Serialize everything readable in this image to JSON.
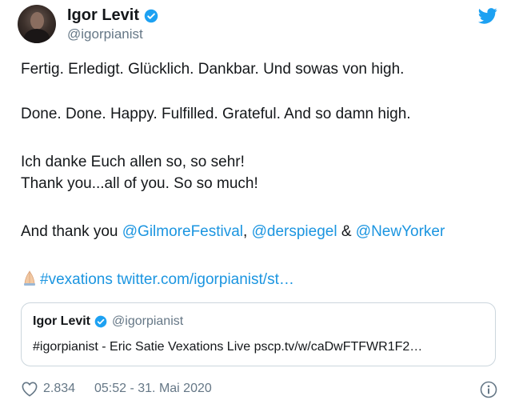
{
  "tweet": {
    "author_name": "Igor Levit",
    "author_handle": "@igorpianist",
    "lines": {
      "l1": "Fertig. Erledigt. Glücklich. Dankbar. Und sowas von high.",
      "l2": "Done. Done. Happy. Fulfilled. Grateful. And so damn high.",
      "l3": "Ich danke Euch allen so, so sehr!",
      "l4": "Thank you...all of you. So so much!",
      "l5_prefix": "And thank you ",
      "l5_link1": "@GilmoreFestival",
      "l5_sep1": ", ",
      "l5_link2": "@derspiegel",
      "l5_sep2": " & ",
      "l5_link3": "@NewYorker",
      "l6_hashtag": "#vexations",
      "l6_url": " twitter.com/igorpianist/st…"
    },
    "quoted": {
      "name": "Igor Levit",
      "handle": "@igorpianist",
      "text": "#igorpianist - Eric Satie Vexations Live pscp.tv/w/caDwFTFWR1F2…"
    },
    "likes": "2.834",
    "timestamp": "05:52 - 31. Mai 2020"
  },
  "colors": {
    "link": "#1b95e0",
    "verified": "#1da1f2",
    "muted": "#657786",
    "border": "#ccd6dd"
  },
  "icons": [
    "avatar",
    "verified-badge-icon",
    "twitter-bird-icon",
    "folded-hands-emoji-icon",
    "heart-icon",
    "info-icon"
  ]
}
